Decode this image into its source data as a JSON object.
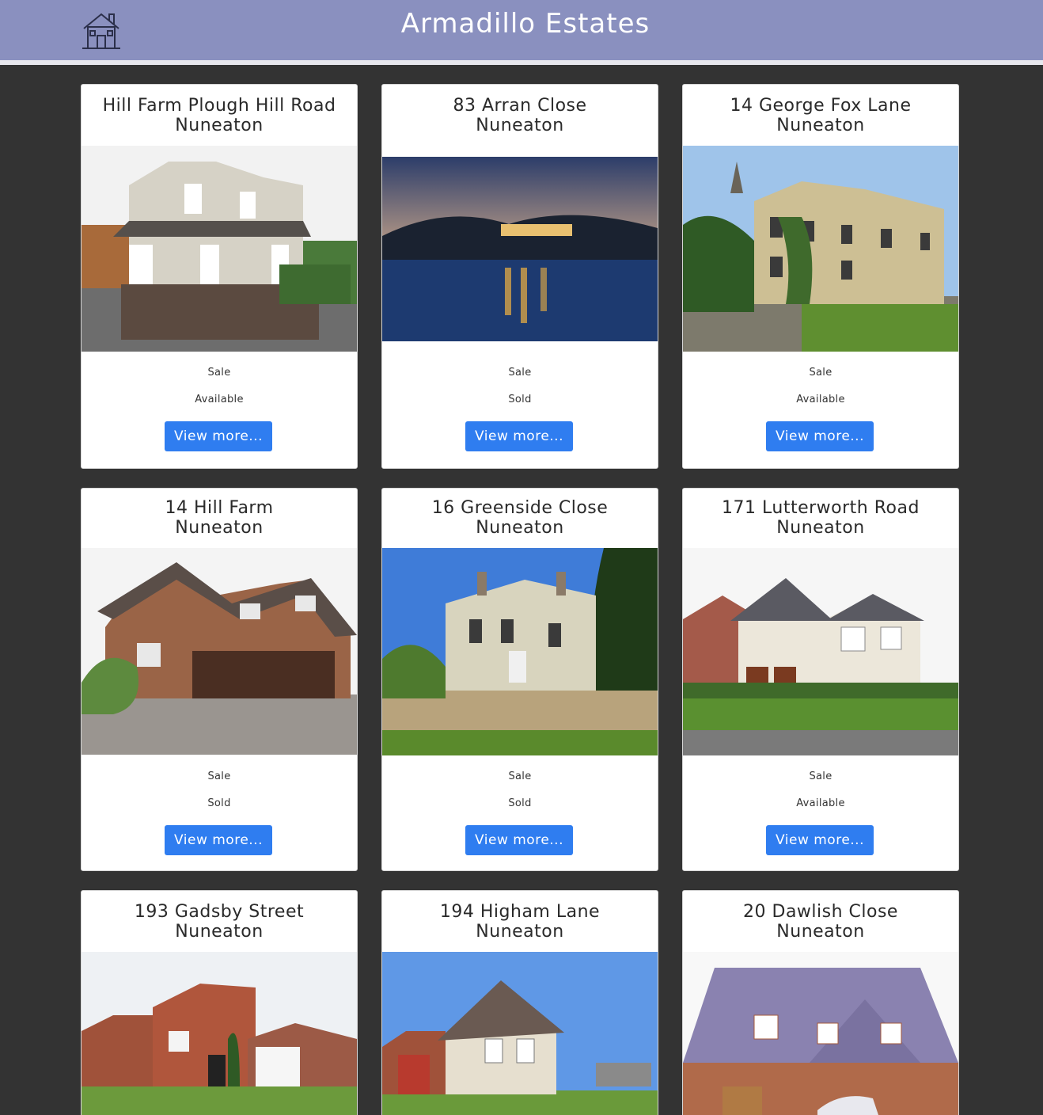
{
  "header": {
    "title": "Armadillo Estates",
    "logo_icon": "house-icon",
    "bg_color": "#8a90bf"
  },
  "properties": [
    {
      "street": "Hill Farm Plough Hill Road",
      "town": "Nuneaton",
      "type": "Sale",
      "status": "Available",
      "button": "View more..."
    },
    {
      "street": "83 Arran Close",
      "town": "Nuneaton",
      "type": "Sale",
      "status": "Sold",
      "button": "View more..."
    },
    {
      "street": "14 George Fox Lane",
      "town": "Nuneaton",
      "type": "Sale",
      "status": "Available",
      "button": "View more..."
    },
    {
      "street": "14 Hill Farm",
      "town": "Nuneaton",
      "type": "Sale",
      "status": "Sold",
      "button": "View more..."
    },
    {
      "street": "16 Greenside Close",
      "town": "Nuneaton",
      "type": "Sale",
      "status": "Sold",
      "button": "View more..."
    },
    {
      "street": "171 Lutterworth Road",
      "town": "Nuneaton",
      "type": "Sale",
      "status": "Available",
      "button": "View more..."
    },
    {
      "street": "193 Gadsby Street",
      "town": "Nuneaton"
    },
    {
      "street": "194 Higham Lane",
      "town": "Nuneaton"
    },
    {
      "street": "20 Dawlish Close",
      "town": "Nuneaton"
    }
  ],
  "colors": {
    "accent": "#2f7df0",
    "page_bg": "#333333"
  }
}
